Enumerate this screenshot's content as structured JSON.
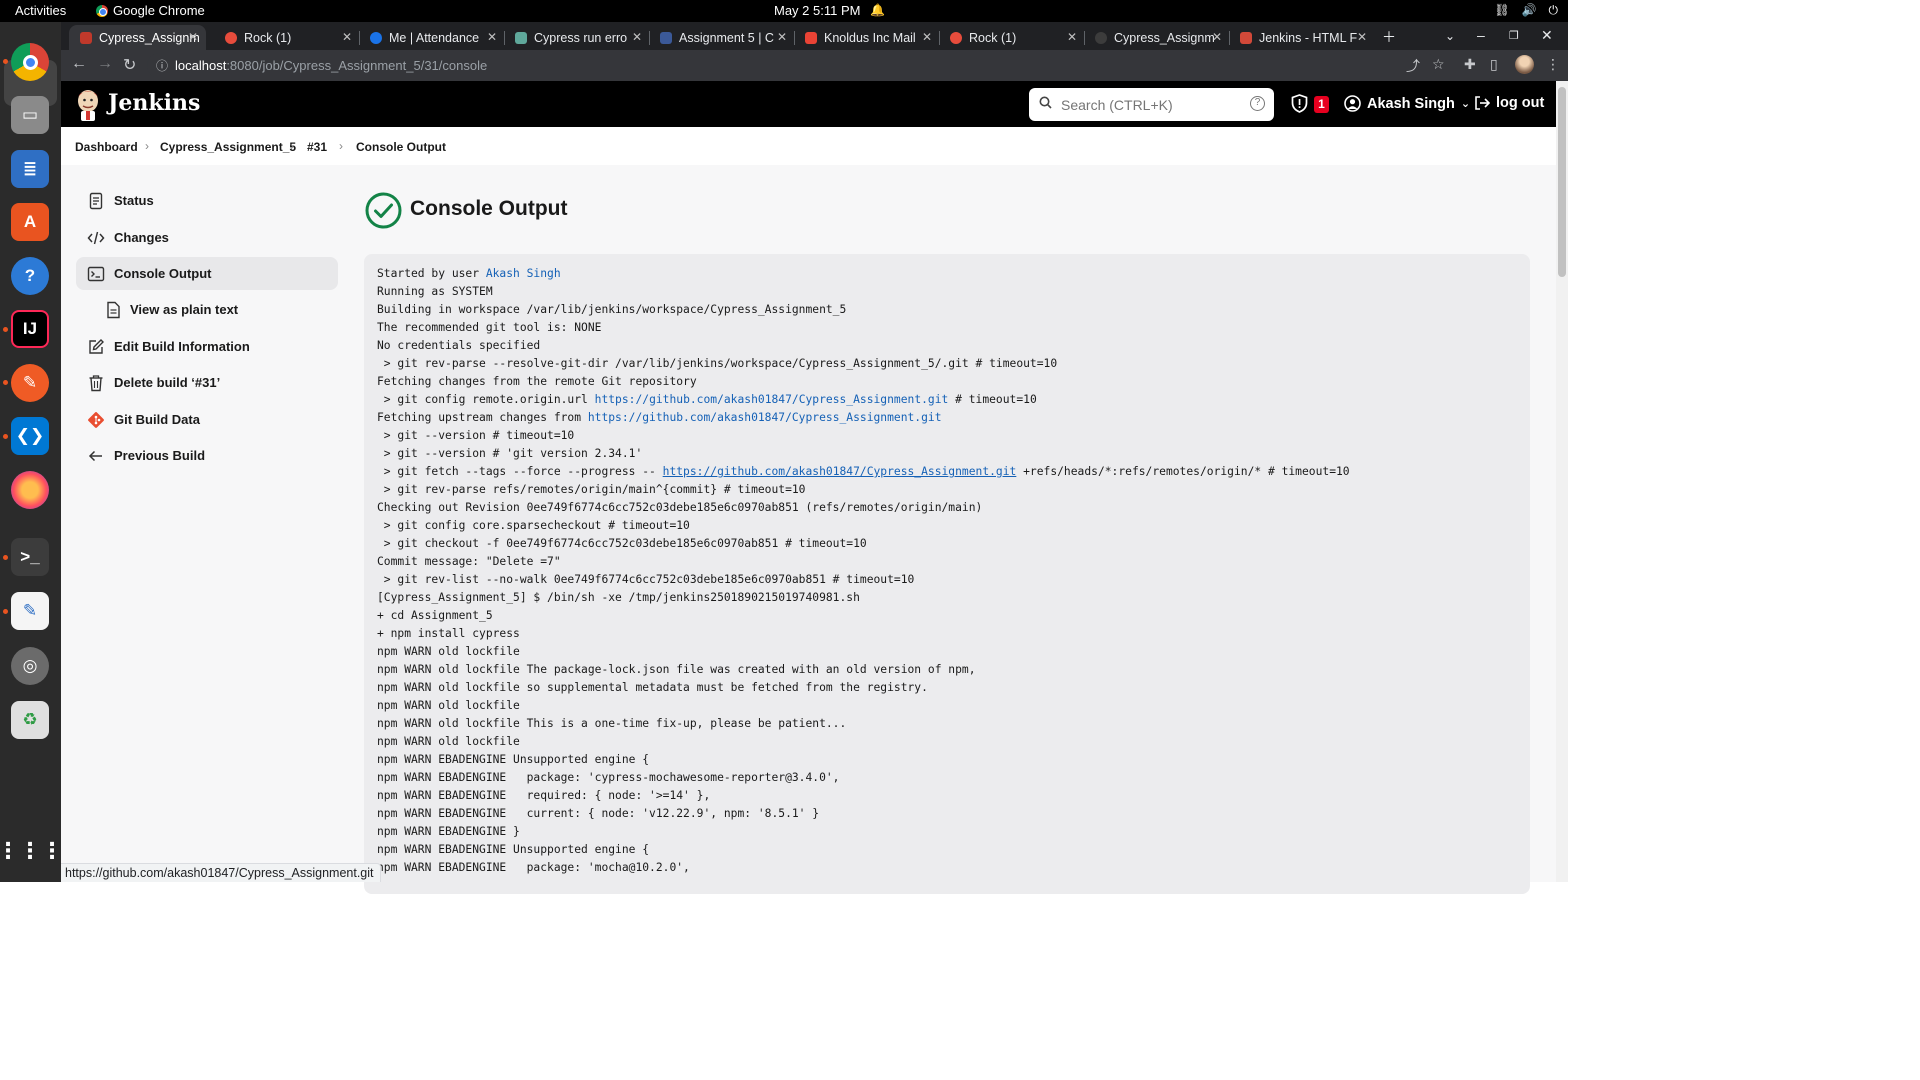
{
  "desktop": {
    "activities": "Activities",
    "app_name": "Google Chrome",
    "clock": "May 2   5:11 PM"
  },
  "browser": {
    "tabs": [
      {
        "title": "Cypress_Assignm",
        "favicon_color": "#c0392b",
        "active": true
      },
      {
        "title": "Rock (1)",
        "favicon_color": "#e74c3c"
      },
      {
        "title": "Me | Attendance",
        "favicon_color": "#1a73e8"
      },
      {
        "title": "Cypress run erro",
        "favicon_color": "#5fa89b"
      },
      {
        "title": "Assignment 5 | C",
        "favicon_color": "#3b5998"
      },
      {
        "title": "Knoldus Inc Mail",
        "favicon_color": "#ea4335"
      },
      {
        "title": "Rock (1)",
        "favicon_color": "#e74c3c"
      },
      {
        "title": "Cypress_Assignm",
        "favicon_color": "#3c3c3c"
      },
      {
        "title": "Jenkins - HTML F",
        "favicon_color": "#d24939"
      }
    ],
    "url_host": "localhost",
    "url_path": ":8080/job/Cypress_Assignment_5/31/console",
    "status_bubble": "https://github.com/akash01847/Cypress_Assignment.git"
  },
  "jenkins": {
    "brand": "Jenkins",
    "search_placeholder": "Search (CTRL+K)",
    "security_badge": "1",
    "user_name": "Akash Singh",
    "logout_label": "log out",
    "accent": "#1561b6",
    "success_color": "#138347"
  },
  "breadcrumb": [
    "Dashboard",
    "Cypress_Assignment_5",
    "#31",
    "Console Output"
  ],
  "sidebar": [
    {
      "label": "Status",
      "icon": "document-icon"
    },
    {
      "label": "Changes",
      "icon": "code-icon"
    },
    {
      "label": "Console Output",
      "icon": "terminal-icon",
      "active": true
    },
    {
      "label": "View as plain text",
      "icon": "file-icon",
      "sub": true
    },
    {
      "label": "Edit Build Information",
      "icon": "edit-icon"
    },
    {
      "label": "Delete build ‘#31’",
      "icon": "trash-icon"
    },
    {
      "label": "Git Build Data",
      "icon": "git-icon"
    },
    {
      "label": "Previous Build",
      "icon": "arrow-left-icon"
    }
  ],
  "main": {
    "title": "Console Output"
  },
  "console_lines": [
    [
      {
        "t": "Started by user "
      },
      {
        "t": "Akash Singh",
        "link": true
      }
    ],
    [
      {
        "t": "Running as SYSTEM"
      }
    ],
    [
      {
        "t": "Building in workspace /var/lib/jenkins/workspace/Cypress_Assignment_5"
      }
    ],
    [
      {
        "t": "The recommended git tool is: NONE"
      }
    ],
    [
      {
        "t": "No credentials specified"
      }
    ],
    [
      {
        "t": " > git rev-parse --resolve-git-dir /var/lib/jenkins/workspace/Cypress_Assignment_5/.git # timeout=10"
      }
    ],
    [
      {
        "t": "Fetching changes from the remote Git repository"
      }
    ],
    [
      {
        "t": " > git config remote.origin.url "
      },
      {
        "t": "https://github.com/akash01847/Cypress_Assignment.git",
        "link": true
      },
      {
        "t": " # timeout=10"
      }
    ],
    [
      {
        "t": "Fetching upstream changes from "
      },
      {
        "t": "https://github.com/akash01847/Cypress_Assignment.git",
        "link": true
      }
    ],
    [
      {
        "t": " > git --version # timeout=10"
      }
    ],
    [
      {
        "t": " > git --version # 'git version 2.34.1'"
      }
    ],
    [
      {
        "t": " > git fetch --tags --force --progress -- "
      },
      {
        "t": "https://github.com/akash01847/Cypress_Assignment.git",
        "link": true,
        "underline": true
      },
      {
        "t": " +refs/heads/*:refs/remotes/origin/* # timeout=10"
      }
    ],
    [
      {
        "t": " > git rev-parse refs/remotes/origin/main^{commit} # timeout=10"
      }
    ],
    [
      {
        "t": "Checking out Revision 0ee749f6774c6cc752c03debe185e6c0970ab851 (refs/remotes/origin/main)"
      }
    ],
    [
      {
        "t": " > git config core.sparsecheckout # timeout=10"
      }
    ],
    [
      {
        "t": " > git checkout -f 0ee749f6774c6cc752c03debe185e6c0970ab851 # timeout=10"
      }
    ],
    [
      {
        "t": "Commit message: \"Delete =7\""
      }
    ],
    [
      {
        "t": " > git rev-list --no-walk 0ee749f6774c6cc752c03debe185e6c0970ab851 # timeout=10"
      }
    ],
    [
      {
        "t": "[Cypress_Assignment_5] $ /bin/sh -xe /tmp/jenkins2501890215019740981.sh"
      }
    ],
    [
      {
        "t": "+ cd Assignment_5"
      }
    ],
    [
      {
        "t": "+ npm install cypress"
      }
    ],
    [
      {
        "t": "npm WARN old lockfile"
      }
    ],
    [
      {
        "t": "npm WARN old lockfile The package-lock.json file was created with an old version of npm,"
      }
    ],
    [
      {
        "t": "npm WARN old lockfile so supplemental metadata must be fetched from the registry."
      }
    ],
    [
      {
        "t": "npm WARN old lockfile"
      }
    ],
    [
      {
        "t": "npm WARN old lockfile This is a one-time fix-up, please be patient..."
      }
    ],
    [
      {
        "t": "npm WARN old lockfile"
      }
    ],
    [
      {
        "t": "npm WARN EBADENGINE Unsupported engine {"
      }
    ],
    [
      {
        "t": "npm WARN EBADENGINE   package: 'cypress-mochawesome-reporter@3.4.0',"
      }
    ],
    [
      {
        "t": "npm WARN EBADENGINE   required: { node: '>=14' },"
      }
    ],
    [
      {
        "t": "npm WARN EBADENGINE   current: { node: 'v12.22.9', npm: '8.5.1' }"
      }
    ],
    [
      {
        "t": "npm WARN EBADENGINE }"
      }
    ],
    [
      {
        "t": "npm WARN EBADENGINE Unsupported engine {"
      }
    ],
    [
      {
        "t": "npm WARN EBADENGINE   package: 'mocha@10.2.0',"
      }
    ]
  ]
}
